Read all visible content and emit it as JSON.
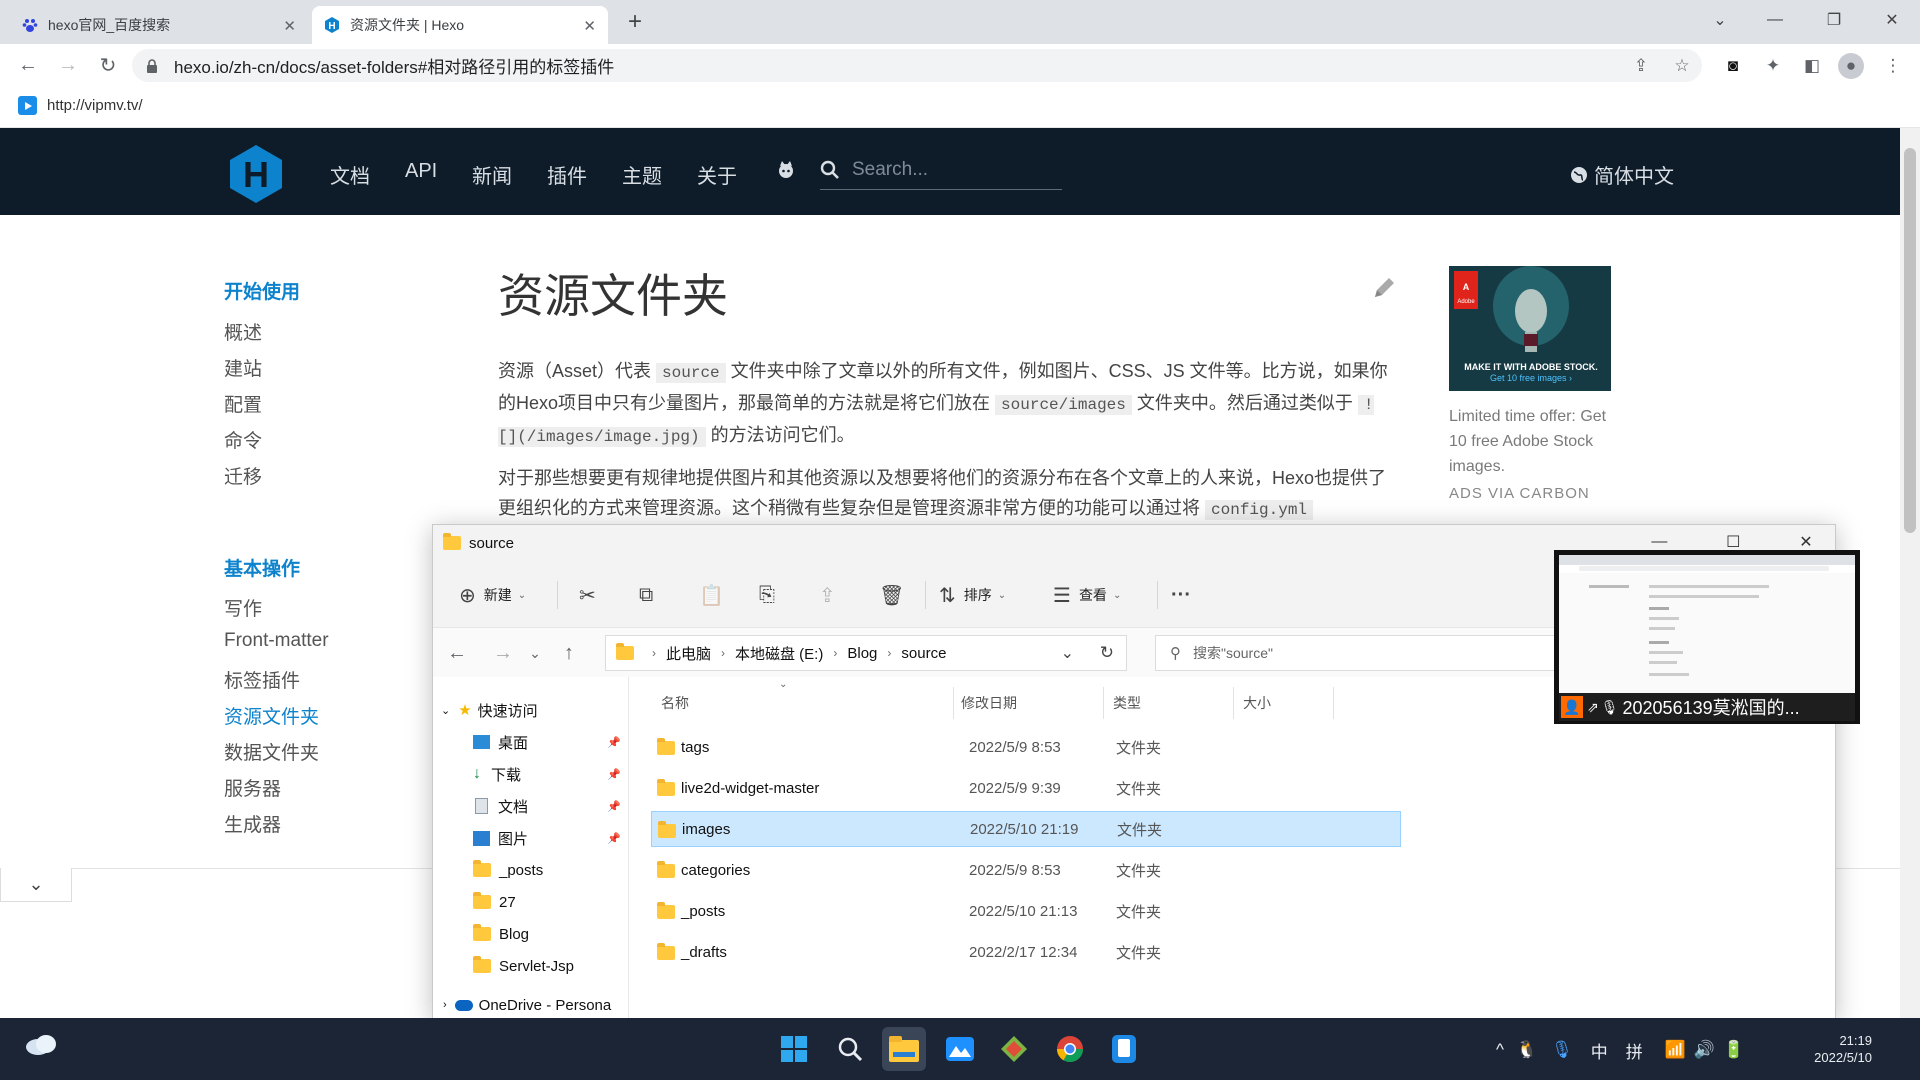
{
  "browser": {
    "tabs": [
      {
        "title": "hexo官网_百度搜索",
        "active": false
      },
      {
        "title": "资源文件夹 | Hexo",
        "active": true
      }
    ],
    "url": "hexo.io/zh-cn/docs/asset-folders#相对路径引用的标签插件",
    "bookmark": "http://vipmv.tv/"
  },
  "site": {
    "nav": [
      "文档",
      "API",
      "新闻",
      "插件",
      "主题",
      "关于"
    ],
    "search_placeholder": "Search...",
    "language": "简体中文"
  },
  "sidebar": {
    "sections": [
      {
        "title": "开始使用",
        "items": [
          "概述",
          "建站",
          "配置",
          "命令",
          "迁移"
        ]
      },
      {
        "title": "基本操作",
        "items": [
          "写作",
          "Front-matter",
          "标签插件",
          "资源文件夹",
          "数据文件夹",
          "服务器",
          "生成器"
        ]
      }
    ],
    "current": "资源文件夹"
  },
  "article": {
    "title": "资源文件夹",
    "p1_a": "资源（Asset）代表",
    "p1_code1": "source",
    "p1_b": "文件夹中除了文章以外的所有文件，例如图片、CSS、JS 文件等。比方说，如果你的Hexo项目中只有少量图片，那最简单的方法就是将它们放在",
    "p1_code2": "source/images",
    "p1_c": "文件夹中。然后通过类似于",
    "p1_code3": "![](/images/image.jpg)",
    "p1_d": "的方法访问它们。",
    "p2_a": "对于那些想要更有规律地提供图片和其他资源以及想要将他们的资源分布在各个文章上的人来说，Hexo也提供了更组织化的方式来管理资源。这个稍微有些复杂但是管理资源非常方便的功能可以通过将",
    "p2_code": "config.yml"
  },
  "ad": {
    "banner_line1": "MAKE IT WITH ADOBE STOCK.",
    "banner_line2": "Get 10 free images ›",
    "text": "Limited time offer: Get 10 free Adobe Stock images.",
    "via": "ADS VIA CARBON",
    "brand": "Adobe"
  },
  "explorer": {
    "title": "source",
    "commands": {
      "new": "新建",
      "sort": "排序",
      "view": "查看"
    },
    "breadcrumb": [
      "此电脑",
      "本地磁盘 (E:)",
      "Blog",
      "source"
    ],
    "search_placeholder": "搜索\"source\"",
    "tree": {
      "quick_access": "快速访问",
      "pinned": [
        "桌面",
        "下载",
        "文档",
        "图片"
      ],
      "folders": [
        "_posts",
        "27",
        "Blog",
        "Servlet-Jsp"
      ],
      "onedrive": "OneDrive - Persona"
    },
    "columns": {
      "name": "名称",
      "date": "修改日期",
      "type": "类型",
      "size": "大小"
    },
    "files": [
      {
        "name": "tags",
        "date": "2022/5/9 8:53",
        "type": "文件夹"
      },
      {
        "name": "live2d-widget-master",
        "date": "2022/5/9 9:39",
        "type": "文件夹"
      },
      {
        "name": "images",
        "date": "2022/5/10 21:19",
        "type": "文件夹"
      },
      {
        "name": "categories",
        "date": "2022/5/9 8:53",
        "type": "文件夹"
      },
      {
        "name": "_posts",
        "date": "2022/5/10 21:13",
        "type": "文件夹"
      },
      {
        "name": "_drafts",
        "date": "2022/2/17 12:34",
        "type": "文件夹"
      }
    ],
    "selected": "images"
  },
  "overlay": {
    "label": "202056139莫淞国的..."
  },
  "taskbar": {
    "tray": {
      "ime": "中",
      "ime2": "拼"
    },
    "time": "21:19",
    "date": "2022/5/10"
  },
  "colors": {
    "hexo_accent": "#0e83cd",
    "hexo_nav_bg": "#0e1c29",
    "taskbar_bg": "#1b2536",
    "selection": "#cce8ff"
  }
}
